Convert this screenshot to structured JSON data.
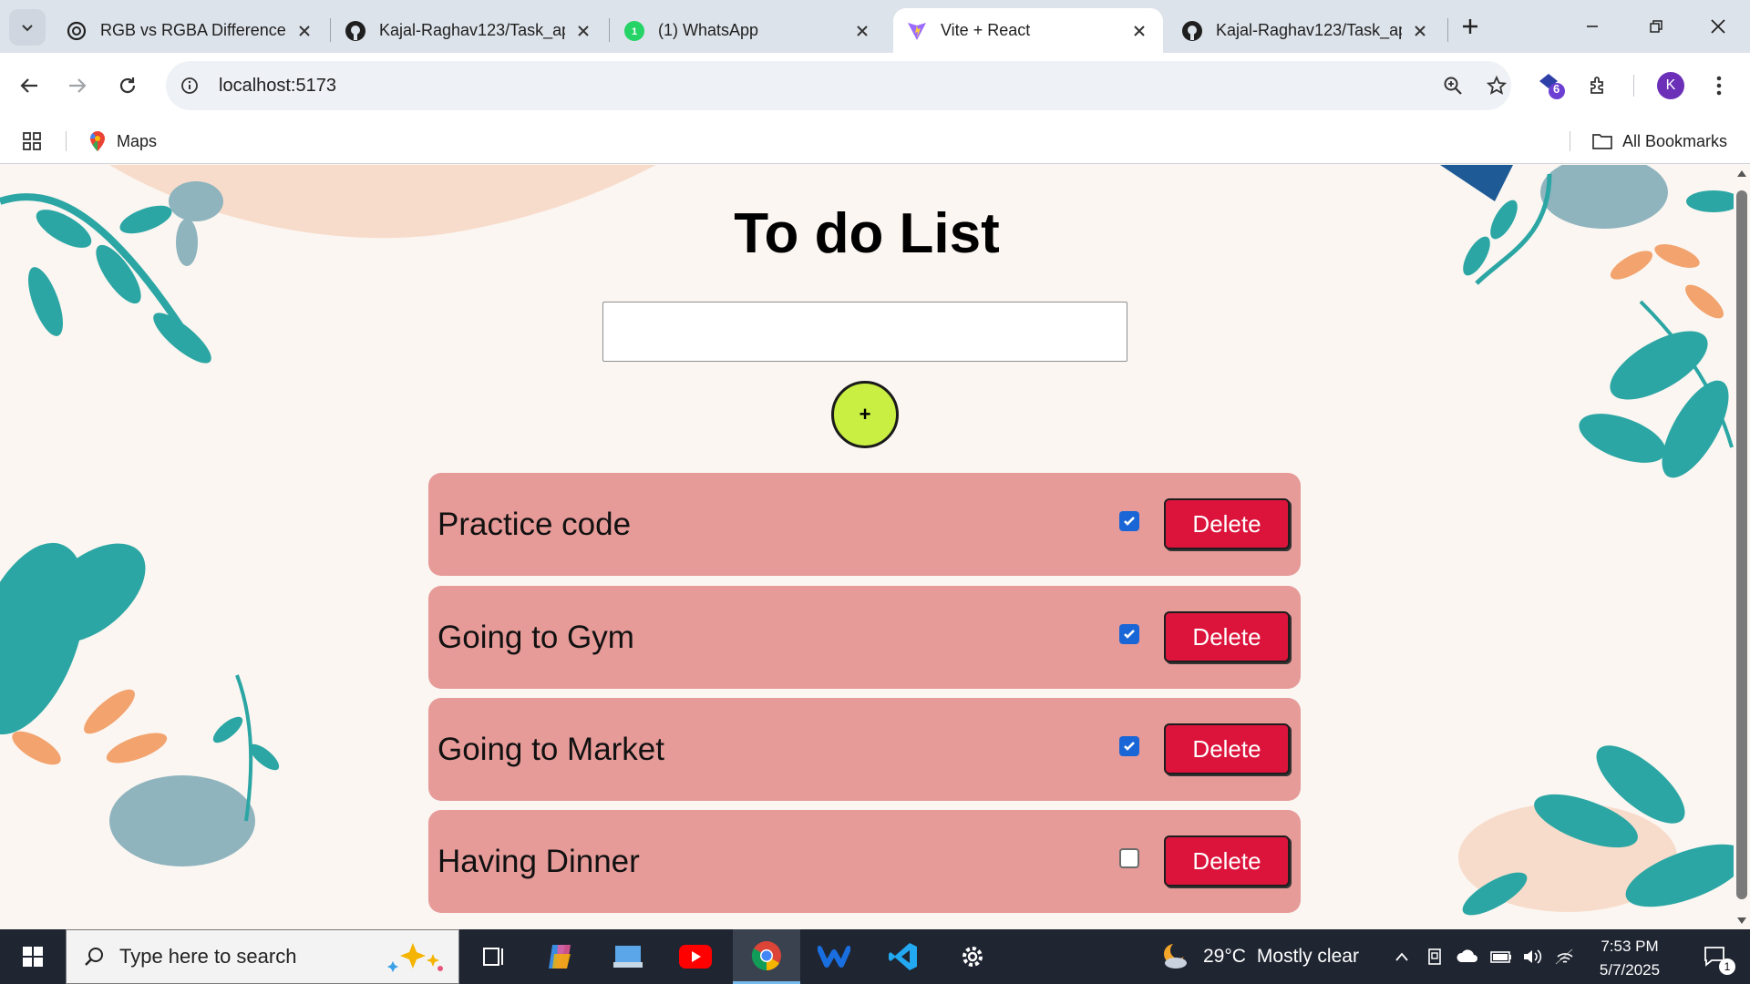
{
  "browser": {
    "tabs": [
      {
        "title": "RGB vs RGBA Difference",
        "favicon": "openai-icon",
        "active": false
      },
      {
        "title": "Kajal-Raghav123/Task_ap",
        "favicon": "github-icon",
        "active": false
      },
      {
        "title": "(1) WhatsApp",
        "favicon": "whatsapp-icon",
        "active": false
      },
      {
        "title": "Vite + React",
        "favicon": "vite-icon",
        "active": true
      },
      {
        "title": "Kajal-Raghav123/Task_ap",
        "favicon": "github-icon",
        "active": false
      }
    ],
    "url": "localhost:5173",
    "extensions_badge": "6",
    "profile_initial": "K",
    "bookmarks": [
      {
        "label": "Maps",
        "icon": "maps-icon"
      }
    ],
    "all_bookmarks_label": "All Bookmarks"
  },
  "app": {
    "title": "To do List",
    "input_value": "",
    "add_button_label": "+",
    "todos": [
      {
        "text": "Practice code",
        "done": true,
        "delete_label": "Delete"
      },
      {
        "text": "Going to Gym",
        "done": true,
        "delete_label": "Delete"
      },
      {
        "text": "Going to Market",
        "done": true,
        "delete_label": "Delete"
      },
      {
        "text": "Having Dinner",
        "done": false,
        "delete_label": "Delete"
      }
    ],
    "colors": {
      "background": "#fbf6f1",
      "todo_card": "#e69b99",
      "delete_button": "#dc143c",
      "add_button": "#c8ef42"
    }
  },
  "taskbar": {
    "search_placeholder": "Type here to search",
    "apps": [
      "task-view-icon",
      "copilot-icon",
      "files-icon",
      "youtube-icon",
      "chrome-icon",
      "webex-icon",
      "vscode-icon",
      "settings-icon"
    ],
    "weather": {
      "temp": "29°C",
      "condition": "Mostly clear"
    },
    "time": "7:53 PM",
    "date": "5/7/2025",
    "notification_count": "1"
  }
}
